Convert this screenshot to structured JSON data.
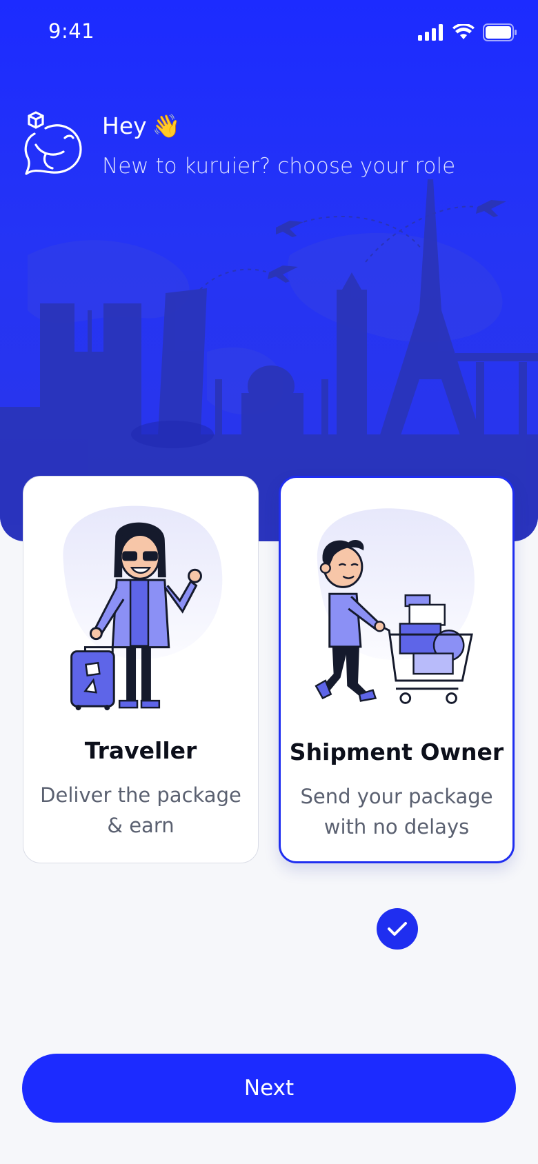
{
  "status_bar": {
    "time": "9:41"
  },
  "header": {
    "greeting": "Hey",
    "wave_emoji": "👋",
    "subtitle": "New to kuruier? choose your role"
  },
  "roles": [
    {
      "title": "Traveller",
      "description": "Deliver the package & earn",
      "selected": false
    },
    {
      "title": "Shipment Owner",
      "description": "Send your package with no delays",
      "selected": true
    }
  ],
  "actions": {
    "next_label": "Next"
  },
  "colors": {
    "primary": "#1c2bff",
    "accent_light": "#8b90f5",
    "text_dark": "#0c0f1a",
    "text_muted": "#5a6070"
  },
  "icons": [
    "signal-icon",
    "wifi-icon",
    "battery-icon",
    "kuruier-logo-icon",
    "check-icon"
  ]
}
